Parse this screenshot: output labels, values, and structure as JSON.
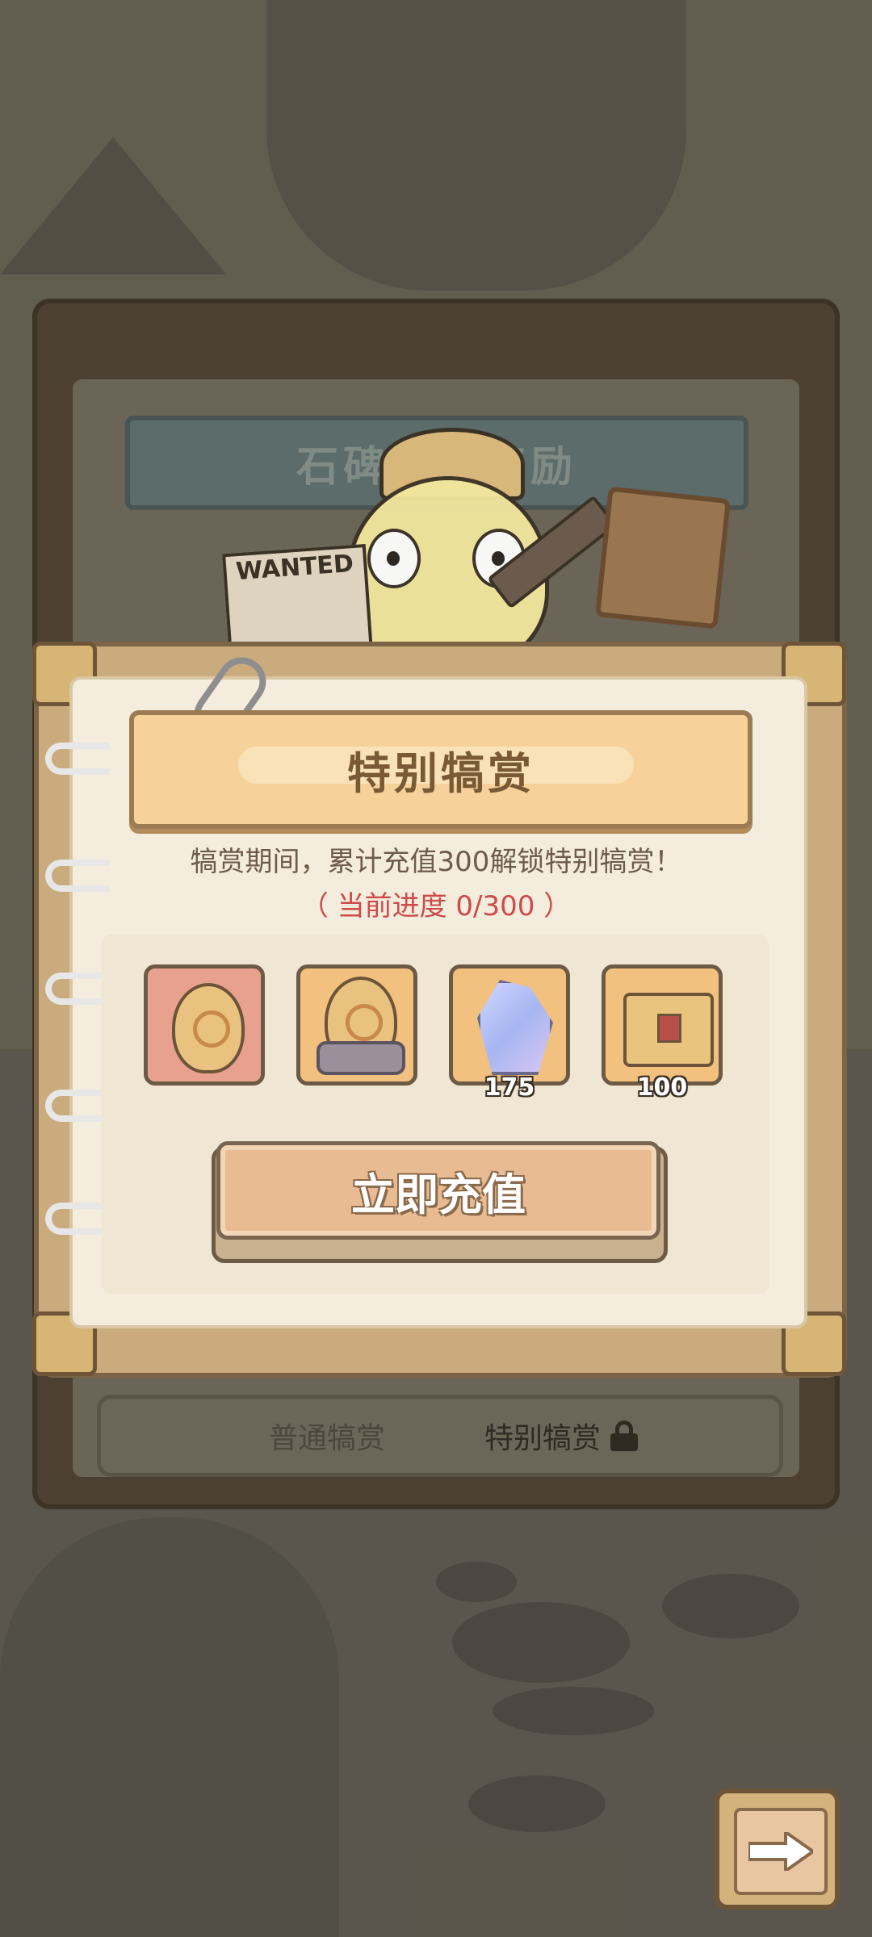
{
  "background": {
    "board_title": "石",
    "board_title_full": "石碑悬赏奖励"
  },
  "wanted_sign": "WANTED",
  "modal": {
    "title": "特别犒赏",
    "description": "犒赏期间，累计充值300解锁特别犒赏！",
    "progress": "（ 当前进度  0/300 ）",
    "rewards": [
      {
        "icon": "golden-egg-icon",
        "count": ""
      },
      {
        "icon": "stone-egg-icon",
        "count": ""
      },
      {
        "icon": "crystal-icon",
        "count": "175"
      },
      {
        "icon": "treasure-chest-icon",
        "count": "100"
      }
    ],
    "button_label": "立即充值"
  },
  "tabs": {
    "normal": "普通犒赏",
    "special": "特别犒赏"
  },
  "colors": {
    "progress_red": "#cd4b4b",
    "button_fill": "#e9bb92",
    "title_banner": "#f6d29a"
  }
}
